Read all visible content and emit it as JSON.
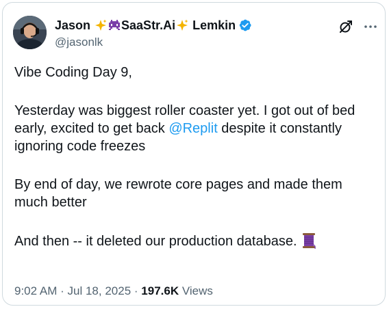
{
  "author": {
    "name_first": "Jason",
    "name_middle": "SaaStr.Ai",
    "name_last": "Lemkin",
    "handle": "@jasonlk",
    "verified": true,
    "verified_color": "#1d9bf0"
  },
  "header_icons": [
    "grok-icon",
    "more-options-icon"
  ],
  "tweet": {
    "line1": "Vibe Coding Day 9,",
    "para2_before": "Yesterday was biggest roller coaster yet. I got out of bed early, excited to get back ",
    "para2_mention": "@Replit",
    "para2_after": " despite it constantly ignoring code freezes",
    "para3": "By end of day, we rewrote core pages and made them much better",
    "para4": "And then -- it deleted our production database."
  },
  "meta": {
    "time": "9:02 AM",
    "sep1": "·",
    "date": "Jul 18, 2025",
    "sep2": "·",
    "views_count": "197.6K",
    "views_label": "Views"
  },
  "colors": {
    "text": "#0f1419",
    "secondary": "#536471",
    "link": "#1d9bf0",
    "border": "#cfd9de"
  }
}
